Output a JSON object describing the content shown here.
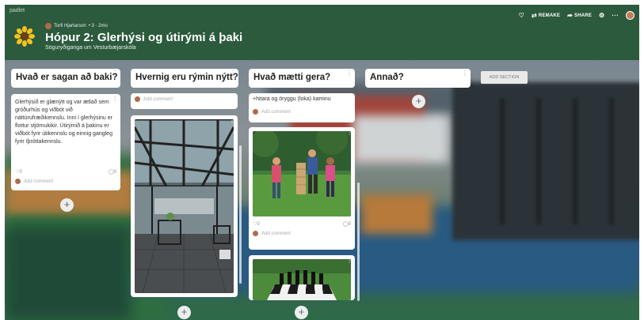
{
  "app": {
    "logo": "padlet"
  },
  "header": {
    "author": "Torfi Hjartarson",
    "meta": "• 3 · 2mo",
    "title": "Hópur 2: Glerhýsi og útirými á þaki",
    "subtitle": "Söguryðiganga um Vesturbæjarskóla",
    "actions": {
      "remake": "REMAKE",
      "share": "SHARE"
    }
  },
  "columns": [
    {
      "title": "Hvað er sagan að baki?"
    },
    {
      "title": "Hvernig eru rýmin nýtt?"
    },
    {
      "title": "Hvað mætti gera?"
    },
    {
      "title": "Annað?"
    }
  ],
  "add_section": "ADD SECTION",
  "cards": {
    "c1_text": "Glerhýsið er glænýtt og var ætlað sem gróðurhús og viðbót við náttúrufræðikennslu. Inni í glerhýsinu er flottur stjörnukikir. Útirýmið á þakinu er viðbót fyrir útikennslu og einnig gangleg fyrir íþróttakennslu.",
    "c1_likes": "0",
    "c1_comments": "0",
    "add_comment": "Add comment",
    "c3_text_partial": "+hitara og öryggu (loka) kaminu",
    "c3_likes": "0",
    "c3_comments": "0"
  },
  "icons": {
    "heart": "heart-icon",
    "remake": "remake-icon",
    "share": "share-icon",
    "settings": "gear-icon",
    "more": "more-icon",
    "plus": "plus-icon",
    "kebab": "kebab-icon",
    "comment": "comment-icon"
  },
  "colors": {
    "header": "#2c5a3d",
    "card": "#ffffff"
  }
}
